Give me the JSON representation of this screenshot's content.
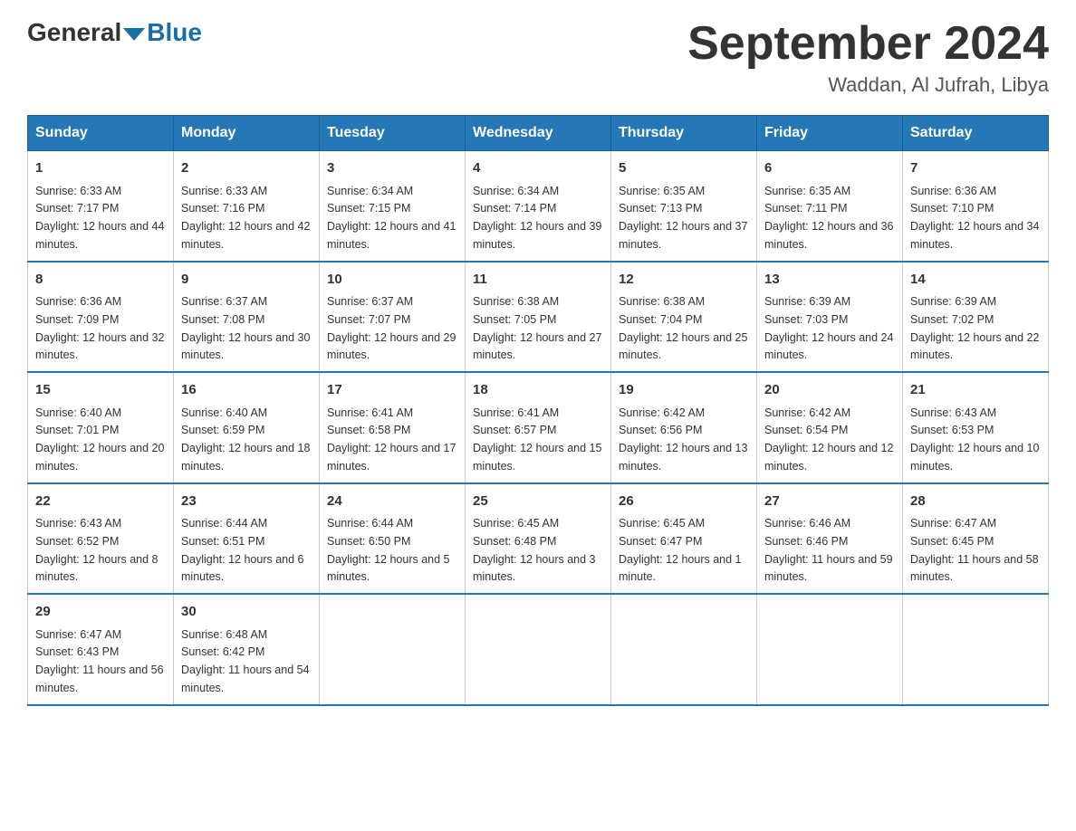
{
  "header": {
    "logo_general": "General",
    "logo_blue": "Blue",
    "title": "September 2024",
    "subtitle": "Waddan, Al Jufrah, Libya"
  },
  "weekdays": [
    "Sunday",
    "Monday",
    "Tuesday",
    "Wednesday",
    "Thursday",
    "Friday",
    "Saturday"
  ],
  "weeks": [
    [
      {
        "day": 1,
        "sunrise": "6:33 AM",
        "sunset": "7:17 PM",
        "daylight": "12 hours and 44 minutes."
      },
      {
        "day": 2,
        "sunrise": "6:33 AM",
        "sunset": "7:16 PM",
        "daylight": "12 hours and 42 minutes."
      },
      {
        "day": 3,
        "sunrise": "6:34 AM",
        "sunset": "7:15 PM",
        "daylight": "12 hours and 41 minutes."
      },
      {
        "day": 4,
        "sunrise": "6:34 AM",
        "sunset": "7:14 PM",
        "daylight": "12 hours and 39 minutes."
      },
      {
        "day": 5,
        "sunrise": "6:35 AM",
        "sunset": "7:13 PM",
        "daylight": "12 hours and 37 minutes."
      },
      {
        "day": 6,
        "sunrise": "6:35 AM",
        "sunset": "7:11 PM",
        "daylight": "12 hours and 36 minutes."
      },
      {
        "day": 7,
        "sunrise": "6:36 AM",
        "sunset": "7:10 PM",
        "daylight": "12 hours and 34 minutes."
      }
    ],
    [
      {
        "day": 8,
        "sunrise": "6:36 AM",
        "sunset": "7:09 PM",
        "daylight": "12 hours and 32 minutes."
      },
      {
        "day": 9,
        "sunrise": "6:37 AM",
        "sunset": "7:08 PM",
        "daylight": "12 hours and 30 minutes."
      },
      {
        "day": 10,
        "sunrise": "6:37 AM",
        "sunset": "7:07 PM",
        "daylight": "12 hours and 29 minutes."
      },
      {
        "day": 11,
        "sunrise": "6:38 AM",
        "sunset": "7:05 PM",
        "daylight": "12 hours and 27 minutes."
      },
      {
        "day": 12,
        "sunrise": "6:38 AM",
        "sunset": "7:04 PM",
        "daylight": "12 hours and 25 minutes."
      },
      {
        "day": 13,
        "sunrise": "6:39 AM",
        "sunset": "7:03 PM",
        "daylight": "12 hours and 24 minutes."
      },
      {
        "day": 14,
        "sunrise": "6:39 AM",
        "sunset": "7:02 PM",
        "daylight": "12 hours and 22 minutes."
      }
    ],
    [
      {
        "day": 15,
        "sunrise": "6:40 AM",
        "sunset": "7:01 PM",
        "daylight": "12 hours and 20 minutes."
      },
      {
        "day": 16,
        "sunrise": "6:40 AM",
        "sunset": "6:59 PM",
        "daylight": "12 hours and 18 minutes."
      },
      {
        "day": 17,
        "sunrise": "6:41 AM",
        "sunset": "6:58 PM",
        "daylight": "12 hours and 17 minutes."
      },
      {
        "day": 18,
        "sunrise": "6:41 AM",
        "sunset": "6:57 PM",
        "daylight": "12 hours and 15 minutes."
      },
      {
        "day": 19,
        "sunrise": "6:42 AM",
        "sunset": "6:56 PM",
        "daylight": "12 hours and 13 minutes."
      },
      {
        "day": 20,
        "sunrise": "6:42 AM",
        "sunset": "6:54 PM",
        "daylight": "12 hours and 12 minutes."
      },
      {
        "day": 21,
        "sunrise": "6:43 AM",
        "sunset": "6:53 PM",
        "daylight": "12 hours and 10 minutes."
      }
    ],
    [
      {
        "day": 22,
        "sunrise": "6:43 AM",
        "sunset": "6:52 PM",
        "daylight": "12 hours and 8 minutes."
      },
      {
        "day": 23,
        "sunrise": "6:44 AM",
        "sunset": "6:51 PM",
        "daylight": "12 hours and 6 minutes."
      },
      {
        "day": 24,
        "sunrise": "6:44 AM",
        "sunset": "6:50 PM",
        "daylight": "12 hours and 5 minutes."
      },
      {
        "day": 25,
        "sunrise": "6:45 AM",
        "sunset": "6:48 PM",
        "daylight": "12 hours and 3 minutes."
      },
      {
        "day": 26,
        "sunrise": "6:45 AM",
        "sunset": "6:47 PM",
        "daylight": "12 hours and 1 minute."
      },
      {
        "day": 27,
        "sunrise": "6:46 AM",
        "sunset": "6:46 PM",
        "daylight": "11 hours and 59 minutes."
      },
      {
        "day": 28,
        "sunrise": "6:47 AM",
        "sunset": "6:45 PM",
        "daylight": "11 hours and 58 minutes."
      }
    ],
    [
      {
        "day": 29,
        "sunrise": "6:47 AM",
        "sunset": "6:43 PM",
        "daylight": "11 hours and 56 minutes."
      },
      {
        "day": 30,
        "sunrise": "6:48 AM",
        "sunset": "6:42 PM",
        "daylight": "11 hours and 54 minutes."
      },
      null,
      null,
      null,
      null,
      null
    ]
  ]
}
